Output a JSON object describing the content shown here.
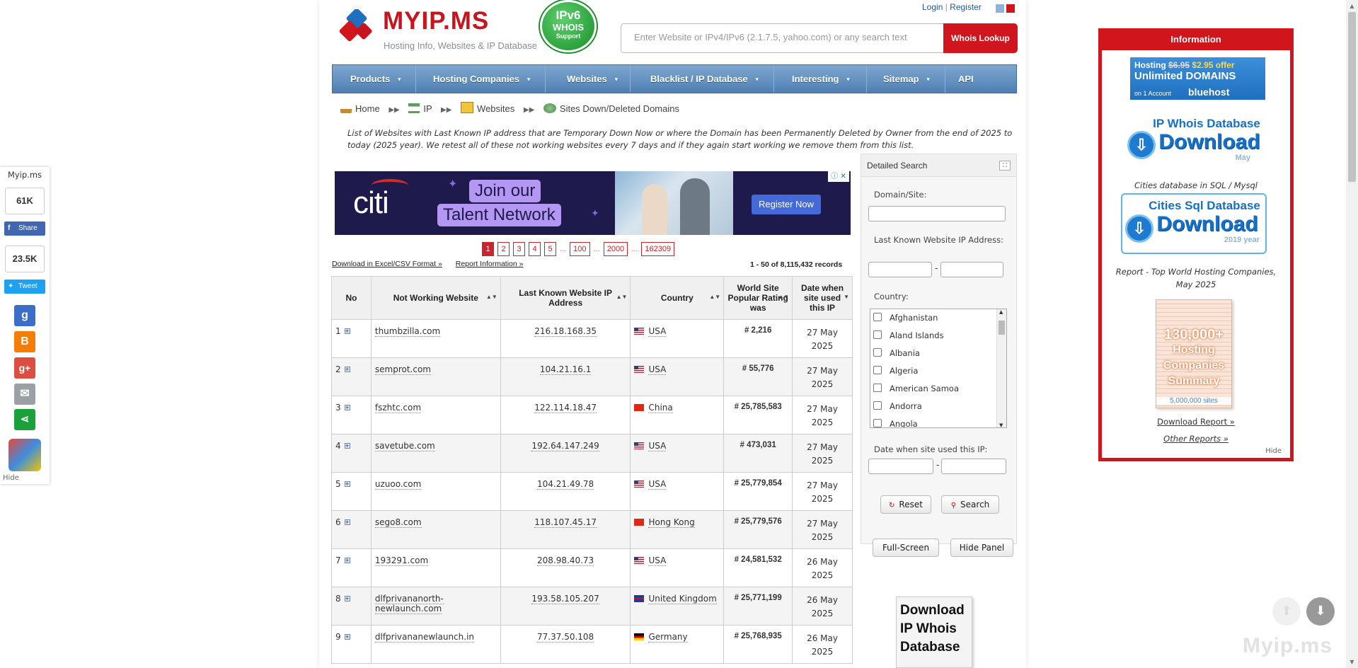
{
  "header": {
    "logo_text": "MYIP.MS",
    "logo_sub": "Hosting Info, Websites & IP Database",
    "ipv6_badge": {
      "line1": "IPv6",
      "line2": "WHOIS",
      "line3": "Support"
    },
    "login": "Login",
    "register": "Register",
    "search_placeholder": "Enter Website or IPv4/IPv6 (2.1.7.5, yahoo.com) or any search text",
    "search_button": "Whois Lookup"
  },
  "nav": [
    "Products",
    "Hosting Companies",
    "Websites",
    "Blacklist / IP Database",
    "Interesting",
    "Sitemap",
    "API"
  ],
  "breadcrumb": [
    "Home",
    "IP",
    "Websites",
    "Sites Down/Deleted Domains"
  ],
  "intro": "List of Websites with Last Known IP address that are Temporary Down Now or where the Domain has been Permanently Deleted by Owner from the end of 2025 to today (2025 year). We retest all of these not working websites every 7 days and if they again start working we remove them from this list.",
  "ad": {
    "brand": "citi",
    "line1": "Join our",
    "line2": "Talent Network",
    "cta": "Register Now"
  },
  "pager": [
    "1",
    "2",
    "3",
    "4",
    "5",
    "...",
    "100",
    "...",
    "2000",
    "...",
    "162309"
  ],
  "links": {
    "excel": "Download in Excel/CSV Format »",
    "report": "Report Information »"
  },
  "records": "1 - 50  of  8,115,432 records",
  "table": {
    "headers": [
      "No",
      "Not Working Website",
      "Last Known Website IP Address",
      "Country",
      "World Site Popular Rating was",
      "Date when site used this IP"
    ],
    "rows": [
      {
        "no": "1",
        "site": "thumbzilla.com",
        "ip": "216.18.168.35",
        "country": "USA",
        "flag": "us",
        "rating": "# 2,216",
        "date1": "27 May",
        "date2": "2025"
      },
      {
        "no": "2",
        "site": "semprot.com",
        "ip": "104.21.16.1",
        "country": "USA",
        "flag": "us",
        "rating": "# 55,776",
        "date1": "27 May",
        "date2": "2025"
      },
      {
        "no": "3",
        "site": "fszhtc.com",
        "ip": "122.114.18.47",
        "country": "China",
        "flag": "cn",
        "rating": "# 25,785,583",
        "date1": "27 May",
        "date2": "2025"
      },
      {
        "no": "4",
        "site": "savetube.com",
        "ip": "192.64.147.249",
        "country": "USA",
        "flag": "us",
        "rating": "# 473,031",
        "date1": "27 May",
        "date2": "2025"
      },
      {
        "no": "5",
        "site": "uzuoo.com",
        "ip": "104.21.49.78",
        "country": "USA",
        "flag": "us",
        "rating": "# 25,779,854",
        "date1": "27 May",
        "date2": "2025"
      },
      {
        "no": "6",
        "site": "sego8.com",
        "ip": "118.107.45.17",
        "country": "Hong Kong",
        "flag": "hk",
        "rating": "# 25,779,576",
        "date1": "27 May",
        "date2": "2025"
      },
      {
        "no": "7",
        "site": "193291.com",
        "ip": "208.98.40.73",
        "country": "USA",
        "flag": "us",
        "rating": "# 24,581,532",
        "date1": "26 May",
        "date2": "2025"
      },
      {
        "no": "8",
        "site": "dlfprivananorth-newlaunch.com",
        "ip": "193.58.105.207",
        "country": "United Kingdom",
        "flag": "uk",
        "rating": "# 25,771,199",
        "date1": "26 May",
        "date2": "2025"
      },
      {
        "no": "9",
        "site": "dlfprivananewlaunch.in",
        "ip": "77.37.50.108",
        "country": "Germany",
        "flag": "de",
        "rating": "# 25,768,935",
        "date1": "26 May",
        "date2": "2025"
      }
    ]
  },
  "search_panel": {
    "title": "Detailed Search",
    "domain_label": "Domain/Site:",
    "ip_label": "Last Known Website IP Address:",
    "country_label": "Country:",
    "countries": [
      "Afghanistan",
      "Aland Islands",
      "Albania",
      "Algeria",
      "American Samoa",
      "Andorra",
      "Angola"
    ],
    "date_label": "Date when site used this IP:",
    "reset": "Reset",
    "search": "Search",
    "fullscreen": "Full-Screen",
    "hide_panel": "Hide Panel",
    "download_book": "Download IP Whois Database"
  },
  "share_bar": {
    "title": "Myip.ms",
    "fb_count": "61K",
    "fb_label": "Share",
    "tw_count": "23.5K",
    "tw_label": "Tweet",
    "hide": "Hide"
  },
  "info_box": {
    "title": "Information",
    "bluehost": {
      "line1_old": "$6.95",
      "line1_pre": "Hosting",
      "line1_new": "$2.95 offer",
      "line2": "Unlimited DOMAINS",
      "line3": "on 1 Account",
      "brand": "bluehost"
    },
    "ipwhois_title": "IP Whois Database",
    "ipwhois_dl": "Download",
    "ipwhois_sub": "May",
    "cities_caption": "Cities database in SQL / Mysql",
    "cities_title": "Cities Sql Database",
    "cities_dl": "Download",
    "cities_sub": "2019 year",
    "report_caption": "Report - Top World Hosting Companies, May 2025",
    "report_big": "130,000+",
    "report_l2": "Hosting",
    "report_l3": "Companies",
    "report_l4": "Summary",
    "report_ft": "5,000,000 sites",
    "download_report": "Download Report  »",
    "other_reports": "Other Reports »",
    "hide": "Hide"
  },
  "watermark": "Myip.ms",
  "colors": {
    "brand_red": "#d0151d",
    "nav_blue": "#5c8bbd",
    "link_blue": "#1c5aa6"
  }
}
